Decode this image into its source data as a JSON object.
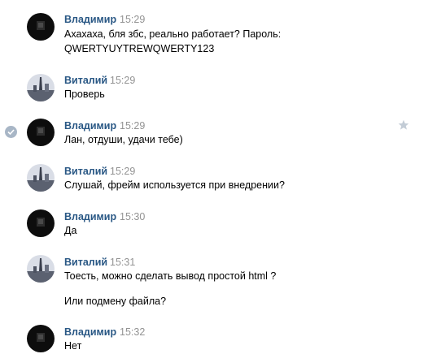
{
  "messages": [
    {
      "author": "Владимир",
      "avatar_icon": "dark-avatar-icon",
      "time": "15:29",
      "lines": [
        "Ахахаха, бля збс, реально работает? Пароль:",
        "QWERTYUYTREWQWERTY123"
      ]
    },
    {
      "author": "Виталий",
      "avatar_icon": "city-avatar-icon",
      "time": "15:29",
      "lines": [
        "Проверь"
      ]
    },
    {
      "author": "Владимир",
      "avatar_icon": "dark-avatar-icon",
      "time": "15:29",
      "lines": [
        "Лан, отдуши, удачи тебе)"
      ],
      "selected": true
    },
    {
      "author": "Виталий",
      "avatar_icon": "city-avatar-icon",
      "time": "15:29",
      "lines": [
        "Слушай, фрейм используется при внедрении?"
      ]
    },
    {
      "author": "Владимир",
      "avatar_icon": "dark-avatar-icon",
      "time": "15:30",
      "lines": [
        "Да"
      ]
    },
    {
      "author": "Виталий",
      "avatar_icon": "city-avatar-icon",
      "time": "15:31",
      "lines": [
        "Тоесть, можно сделать вывод простой html ?",
        "Или подмену файла?"
      ]
    },
    {
      "author": "Владимир",
      "avatar_icon": "dark-avatar-icon",
      "time": "15:32",
      "lines": [
        "Нет"
      ]
    }
  ],
  "colors": {
    "author": "#2a5885",
    "time": "#939393",
    "text": "#000000",
    "check": "#a8b6c6",
    "star": "#c3ccd6"
  }
}
